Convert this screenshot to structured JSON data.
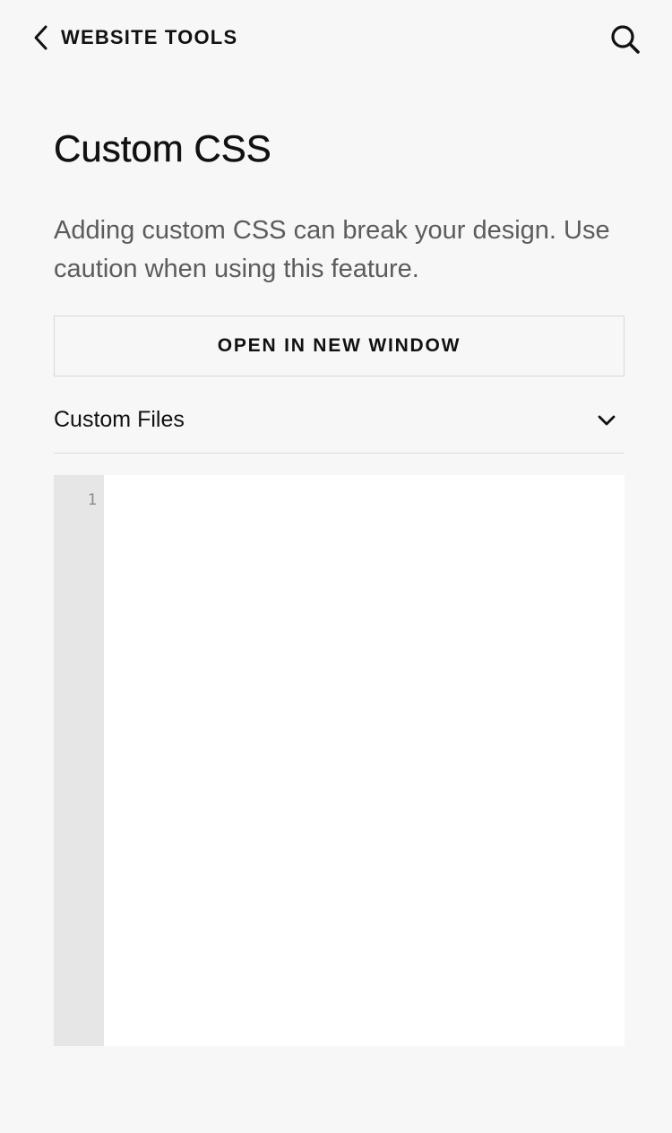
{
  "header": {
    "back_label": "WEBSITE TOOLS",
    "back_icon": "chevron-left-icon",
    "search_icon": "search-icon"
  },
  "page": {
    "title": "Custom CSS",
    "warning": "Adding custom CSS can break your design. Use caution when using this feature."
  },
  "actions": {
    "open_new_window_label": "OPEN IN NEW WINDOW"
  },
  "custom_files": {
    "label": "Custom Files",
    "toggle_icon": "chevron-down-icon"
  },
  "editor": {
    "line_numbers": [
      "1"
    ],
    "content": ""
  },
  "colors": {
    "background": "#f7f7f7",
    "text_primary": "#111111",
    "text_secondary": "#5c5c5c",
    "border": "#d8d8d8",
    "gutter": "#e6e6e6",
    "editor_bg": "#ffffff"
  }
}
